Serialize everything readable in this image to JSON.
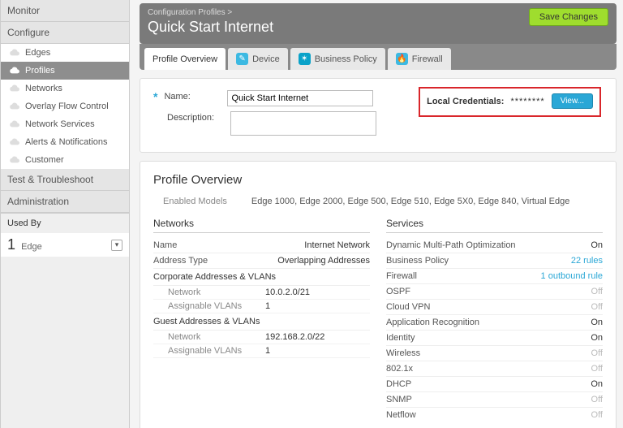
{
  "nav": {
    "monitor": "Monitor",
    "configure": "Configure",
    "items": [
      {
        "label": "Edges"
      },
      {
        "label": "Profiles"
      },
      {
        "label": "Networks"
      },
      {
        "label": "Overlay Flow Control"
      },
      {
        "label": "Network Services"
      },
      {
        "label": "Alerts & Notifications"
      },
      {
        "label": "Customer"
      }
    ],
    "test": "Test & Troubleshoot",
    "admin": "Administration",
    "used_by_label": "Used By",
    "used_by_count": "1",
    "used_by_unit": "Edge"
  },
  "header": {
    "breadcrumb": "Configuration Profiles >",
    "title": "Quick Start Internet",
    "save": "Save Changes"
  },
  "tabs": [
    {
      "label": "Profile Overview"
    },
    {
      "label": "Device"
    },
    {
      "label": "Business Policy"
    },
    {
      "label": "Firewall"
    }
  ],
  "form": {
    "name_label": "Name:",
    "name_value": "Quick Start Internet",
    "desc_label": "Description:",
    "desc_value": ""
  },
  "cred": {
    "label": "Local Credentials:",
    "mask": "********",
    "view": "View..."
  },
  "overview": {
    "title": "Profile Overview",
    "enabled_label": "Enabled Models",
    "enabled_value": "Edge 1000, Edge 2000, Edge 500, Edge 510, Edge 5X0, Edge 840, Virtual Edge",
    "networks_title": "Networks",
    "services_title": "Services",
    "net_header": {
      "name": "Name",
      "value": "Internet Network"
    },
    "net_addr": {
      "name": "Address Type",
      "value": "Overlapping Addresses"
    },
    "corp_title": "Corporate Addresses & VLANs",
    "corp": {
      "net_label": "Network",
      "net_value": "10.0.2.0/21",
      "vlan_label": "Assignable VLANs",
      "vlan_value": "1"
    },
    "guest_title": "Guest Addresses & VLANs",
    "guest": {
      "net_label": "Network",
      "net_value": "192.168.2.0/22",
      "vlan_label": "Assignable VLANs",
      "vlan_value": "1"
    },
    "services": [
      {
        "k": "Dynamic Multi-Path Optimization",
        "v": "On",
        "cls": ""
      },
      {
        "k": "Business Policy",
        "v": "22 rules",
        "cls": "link"
      },
      {
        "k": "Firewall",
        "v": "1 outbound rule",
        "cls": "link"
      },
      {
        "k": "OSPF",
        "v": "Off",
        "cls": "off"
      },
      {
        "k": "Cloud VPN",
        "v": "Off",
        "cls": "off"
      },
      {
        "k": "Application Recognition",
        "v": "On",
        "cls": ""
      },
      {
        "k": "Identity",
        "v": "On",
        "cls": ""
      },
      {
        "k": "Wireless",
        "v": "Off",
        "cls": "off"
      },
      {
        "k": "802.1x",
        "v": "Off",
        "cls": "off"
      },
      {
        "k": "DHCP",
        "v": "On",
        "cls": ""
      },
      {
        "k": "SNMP",
        "v": "Off",
        "cls": "off"
      },
      {
        "k": "Netflow",
        "v": "Off",
        "cls": "off"
      }
    ]
  }
}
